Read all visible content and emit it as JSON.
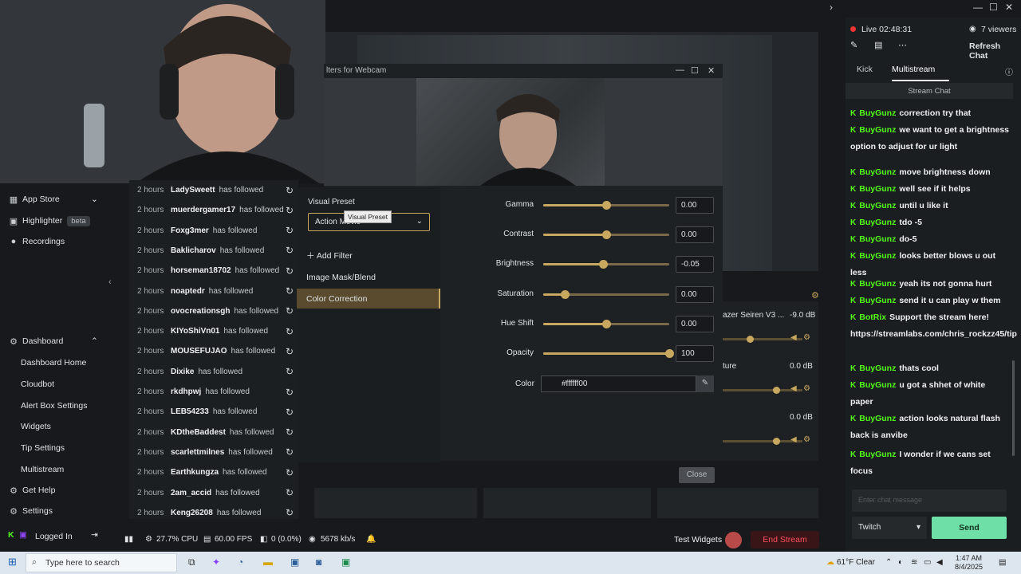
{
  "window": {
    "minimize": "—",
    "maximize": "☐",
    "close": "✕",
    "expand": "›"
  },
  "nav": {
    "app_store": "App Store",
    "highlighter": "Highlighter",
    "highlighter_badge": "beta",
    "recordings": "Recordings",
    "dashboard": "Dashboard",
    "dashboard_items": [
      "Dashboard Home",
      "Cloudbot",
      "Alert Box Settings",
      "Widgets",
      "Tip Settings",
      "Multistream"
    ],
    "get_help": "Get Help",
    "settings": "Settings",
    "logged_in": "Logged In"
  },
  "feed": [
    {
      "time": "2 hours",
      "name": "LadySweett",
      "action": "has followed"
    },
    {
      "time": "2 hours",
      "name": "muerdergamer17",
      "action": "has followed"
    },
    {
      "time": "2 hours",
      "name": "Foxg3mer",
      "action": "has followed"
    },
    {
      "time": "2 hours",
      "name": "Baklicharov",
      "action": "has followed"
    },
    {
      "time": "2 hours",
      "name": "horseman18702",
      "action": "has followed"
    },
    {
      "time": "2 hours",
      "name": "noaptedr",
      "action": "has followed"
    },
    {
      "time": "2 hours",
      "name": "ovocreationsgh",
      "action": "has followed"
    },
    {
      "time": "2 hours",
      "name": "KIYoShiVn01",
      "action": "has followed"
    },
    {
      "time": "2 hours",
      "name": "MOUSEFUJAO",
      "action": "has followed"
    },
    {
      "time": "2 hours",
      "name": "Dixike",
      "action": "has followed"
    },
    {
      "time": "2 hours",
      "name": "rkdhpwj",
      "action": "has followed"
    },
    {
      "time": "2 hours",
      "name": "LEB54233",
      "action": "has followed"
    },
    {
      "time": "2 hours",
      "name": "KDtheBaddest",
      "action": "has followed"
    },
    {
      "time": "2 hours",
      "name": "scarlettmilnes",
      "action": "has followed"
    },
    {
      "time": "2 hours",
      "name": "Earthkungza",
      "action": "has followed"
    },
    {
      "time": "2 hours",
      "name": "2am_accid",
      "action": "has followed"
    },
    {
      "time": "2 hours",
      "name": "Keng26208",
      "action": "has followed"
    }
  ],
  "dialog": {
    "title": "lters for Webcam",
    "visual_preset_label": "Visual Preset",
    "tooltip": "Visual Preset",
    "preset_value": "Action Movie",
    "add_filter": "Add Filter",
    "filters": [
      "Image Mask/Blend",
      "Color Correction"
    ],
    "properties": [
      {
        "label": "Gamma",
        "value": "0.00",
        "level": 0.5
      },
      {
        "label": "Contrast",
        "value": "0.00",
        "level": 0.5
      },
      {
        "label": "Brightness",
        "value": "-0.05",
        "level": 0.475
      },
      {
        "label": "Saturation",
        "value": "0.00",
        "level": 0.17
      },
      {
        "label": "Hue Shift",
        "value": "0.00",
        "level": 0.5
      },
      {
        "label": "Opacity",
        "value": "100",
        "level": 1.0
      }
    ],
    "color_label": "Color",
    "color_value": "#ffffff00",
    "close": "Close"
  },
  "mixer": [
    {
      "label": "azer Seiren V3 ...",
      "db": "-9.0 dB"
    },
    {
      "label": "ture",
      "db": "0.0 dB"
    },
    {
      "label": "",
      "db": "0.0 dB"
    }
  ],
  "status": {
    "cpu": "27.7% CPU",
    "fps": "60.00 FPS",
    "dropped": "0 (0.0%)",
    "bitrate": "5678 kb/s",
    "test_widgets": "Test Widgets",
    "end_stream": "End Stream"
  },
  "chat": {
    "live": "Live 02:48:31",
    "viewers": "7 viewers",
    "refresh": "Refresh Chat",
    "tab_kick": "Kick",
    "tab_multistream": "Multistream",
    "stream_chat": "Stream Chat",
    "messages": [
      {
        "user": "BuyGunz",
        "text": "correction try that"
      },
      {
        "user": "BuyGunz",
        "text": "we want to get a brightness option to adjust for ur light"
      },
      {
        "user": "BuyGunz",
        "text": "move brightness down"
      },
      {
        "user": "BuyGunz",
        "text": "well see if it helps"
      },
      {
        "user": "BuyGunz",
        "text": "until u like it"
      },
      {
        "user": "BuyGunz",
        "text": "tdo -5"
      },
      {
        "user": "BuyGunz",
        "text": "do-5"
      },
      {
        "user": "BuyGunz",
        "text": "looks better blows u out less"
      },
      {
        "user": "BuyGunz",
        "text": "yeah its not gonna hurt"
      },
      {
        "user": "BuyGunz",
        "text": "send it u can play w them"
      },
      {
        "user": "BotRix",
        "text": "Support the stream here! https://streamlabs.com/chris_rockzz45/tip"
      },
      {
        "user": "BuyGunz",
        "text": "thats cool"
      },
      {
        "user": "BuyGunz",
        "text": "u got a shhet of white paper"
      },
      {
        "user": "BuyGunz",
        "text": "action looks natural flash back is anvibe"
      },
      {
        "user": "BuyGunz",
        "text": "I wonder if we cans set focus"
      }
    ],
    "input_placeholder": "Enter chat message",
    "platform": "Twitch",
    "send": "Send"
  },
  "taskbar": {
    "search_placeholder": "Type here to search",
    "weather": "61°F  Clear",
    "time": "1:47 AM",
    "date": "8/4/2025"
  },
  "colors": {
    "accent": "#c8a85e",
    "kick_green": "#53fc18",
    "send": "#6ee0a7",
    "end_stream": "#ff4f5e"
  }
}
